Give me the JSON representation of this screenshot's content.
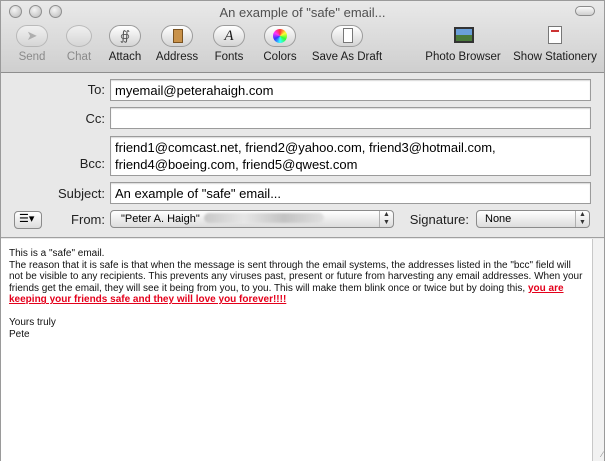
{
  "window": {
    "title": "An example of \"safe\" email..."
  },
  "toolbar": {
    "send": "Send",
    "chat": "Chat",
    "attach": "Attach",
    "address": "Address",
    "fonts": "Fonts",
    "colors": "Colors",
    "save_draft": "Save As Draft",
    "photo_browser": "Photo Browser",
    "show_stationery": "Show Stationery"
  },
  "header": {
    "to_label": "To:",
    "to_value": "myemail@peterahaigh.com",
    "cc_label": "Cc:",
    "cc_value": "",
    "bcc_label": "Bcc:",
    "bcc_line1": "friend1@comcast.net, friend2@yahoo.com, friend3@hotmail.com,",
    "bcc_line2": "friend4@boeing.com, friend5@qwest.com",
    "subject_label": "Subject:",
    "subject_value": "An example of \"safe\" email...",
    "from_label": "From:",
    "from_value": "\"Peter A. Haigh\"",
    "signature_label": "Signature:",
    "signature_value": "None"
  },
  "body": {
    "line1": "This is a \"safe\" email.",
    "para": "The reason that it is safe is that when the message is sent through the email systems, the addresses listed in the \"bcc\" field will not be visible to any recipients. This prevents any viruses past, present or future from harvesting any email addresses. When your friends get the email, they will see it being from you, to you. This will make them blink once or twice but by doing this, ",
    "highlight": "you are keeping your friends safe and they will love you forever!!!!",
    "closing": "Yours truly",
    "name": "Pete"
  },
  "colors": {
    "highlight": "#e4001b"
  },
  "icons": [
    "send-icon",
    "chat-icon",
    "attach-icon",
    "address-icon",
    "fonts-icon",
    "colors-icon",
    "save-draft-icon",
    "photo-browser-icon",
    "stationery-icon",
    "list-format-icon"
  ]
}
